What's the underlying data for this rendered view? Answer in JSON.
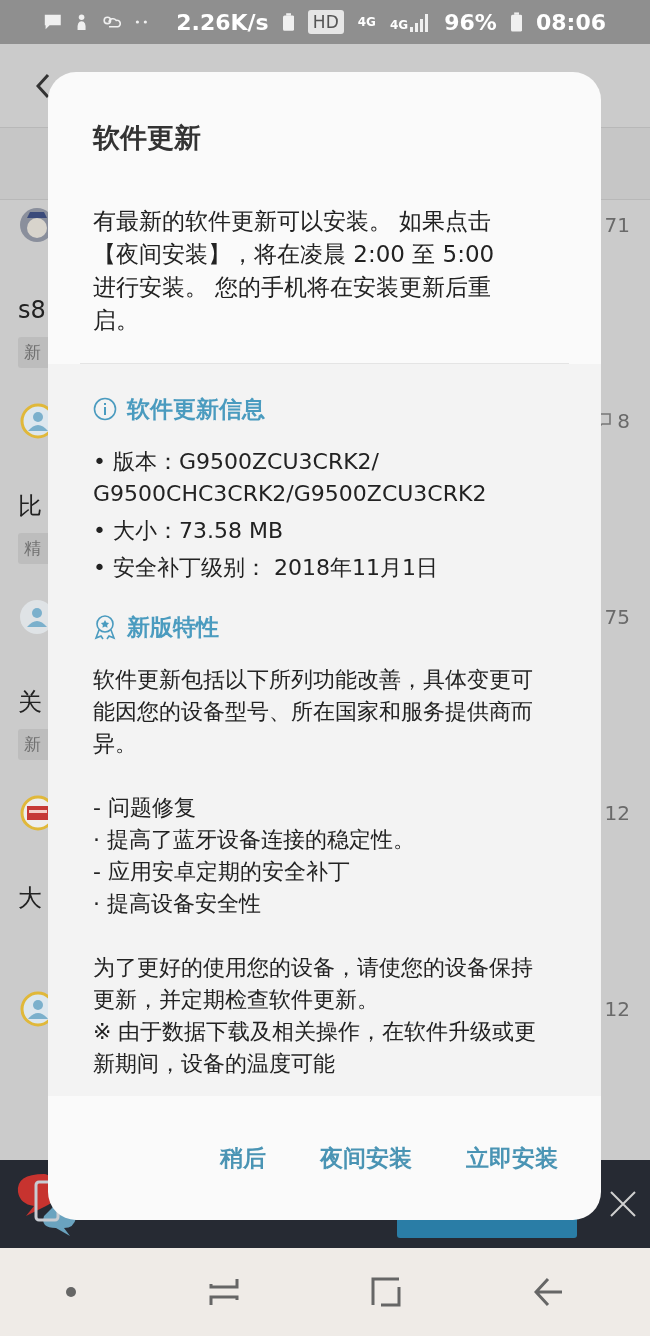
{
  "status_bar": {
    "network_speed": "2.26K/s",
    "hd_badge": "HD",
    "network_type": "4G",
    "signal_type": "4G",
    "battery": "96%",
    "time": "08:06"
  },
  "background_list": [
    {
      "count": "71",
      "comment_icon": false,
      "title": "s8",
      "tag": "新"
    },
    {
      "count": "8",
      "comment_icon": true,
      "title": "比",
      "tag": "精"
    },
    {
      "count": "75",
      "comment_icon": false,
      "title": "关",
      "tag": "新"
    },
    {
      "count": "12",
      "comment_icon": false,
      "title": "大"
    },
    {
      "count": "12",
      "comment_icon": false
    }
  ],
  "dialog": {
    "title": "软件更新",
    "message": "有最新的软件更新可以安装。 如果点击【夜间安装】，将在凌晨 2:00 至 5:00 进行安装。 您的手机将在安装更新后重启。",
    "info_section": {
      "heading": "软件更新信息",
      "items": [
        "• 版本：G9500ZCU3CRK2/\nG9500CHC3CRK2/G9500ZCU3CRK2",
        "• 大小：73.58 MB",
        "• 安全补丁级别： 2018年11月1日"
      ]
    },
    "features_section": {
      "heading": "新版特性",
      "paragraphs": [
        "软件更新包括以下所列功能改善，具体变更可能因您的设备型号、所在国家和服务提供商而异。",
        "- 问题修复\n · 提高了蓝牙设备连接的稳定性。\n- 应用安卓定期的安全补丁\n · 提高设备安全性",
        "为了更好的使用您的设备，请使您的设备保持更新，并定期检查软件更新。\n※ 由于数据下载及相关操作，在软件升级或更新期间，设备的温度可能"
      ]
    },
    "buttons": [
      "稍后",
      "夜间安装",
      "立即安装"
    ]
  }
}
